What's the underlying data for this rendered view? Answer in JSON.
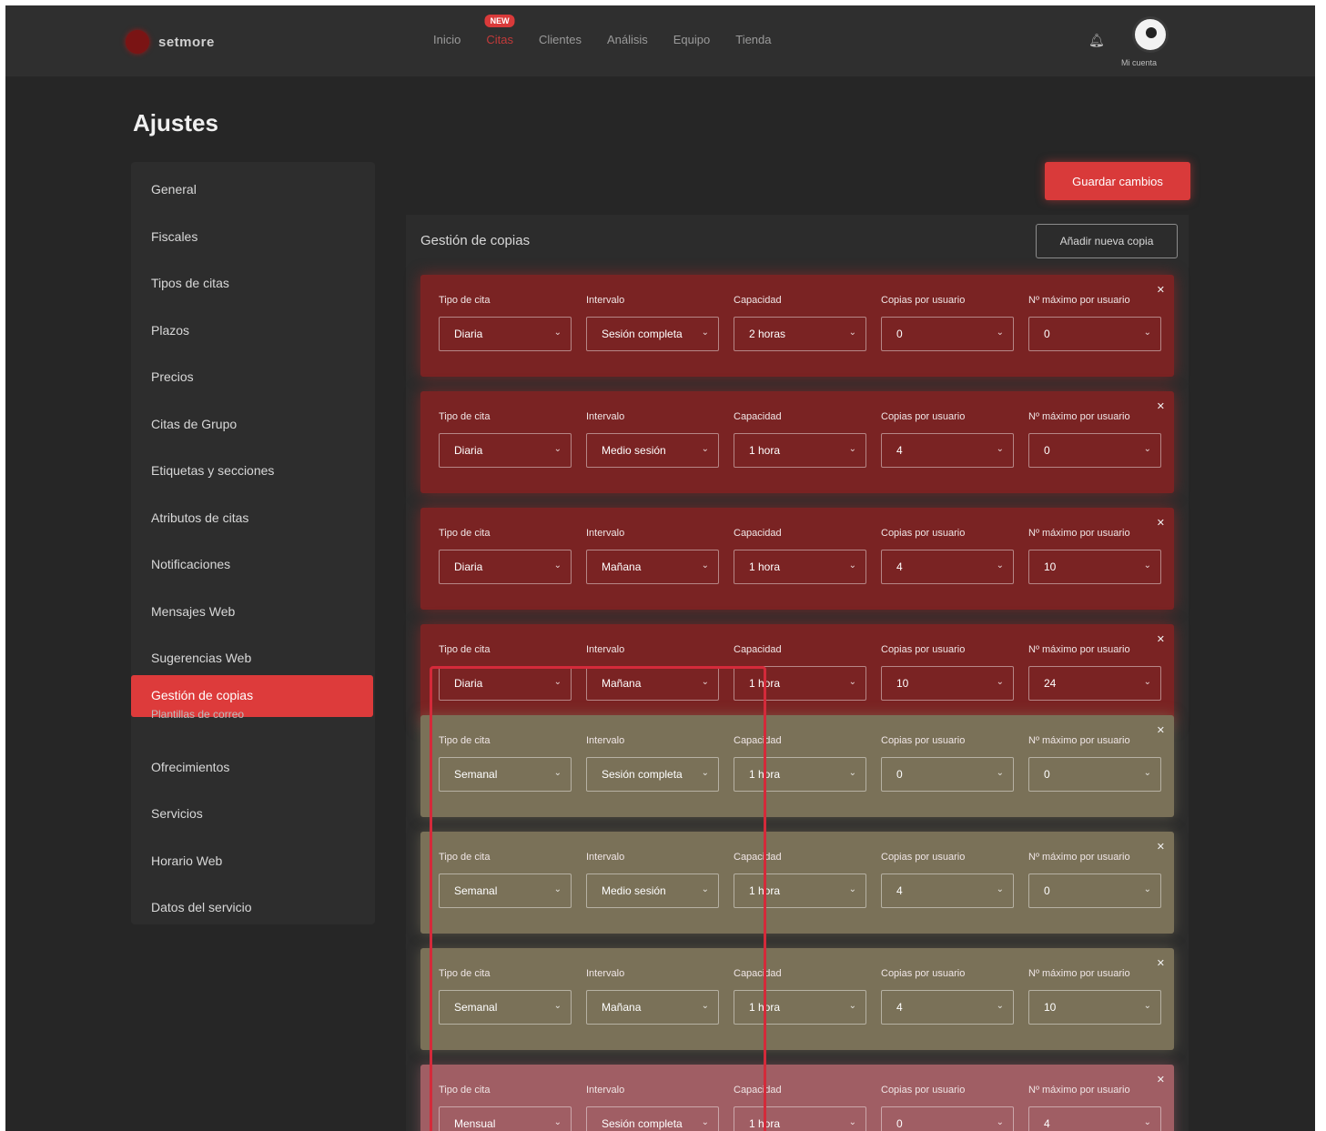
{
  "page": {
    "title": "Ajustes"
  },
  "header": {
    "logo_text": "setmore",
    "nav": [
      {
        "label": "Inicio"
      },
      {
        "label": "Citas",
        "badge": "NEW",
        "active": true
      },
      {
        "label": "Clientes"
      },
      {
        "label": "Análisis"
      },
      {
        "label": "Equipo"
      },
      {
        "label": "Tienda"
      }
    ],
    "user_label": "Mi cuenta"
  },
  "sidebar": {
    "items": [
      {
        "label": "General"
      },
      {
        "label": "Fiscales"
      },
      {
        "label": "Tipos de citas"
      },
      {
        "label": "Plazos"
      },
      {
        "label": "Precios"
      },
      {
        "label": "Citas de Grupo"
      },
      {
        "label": "Etiquetas y secciones"
      },
      {
        "label": "Atributos de citas"
      },
      {
        "label": "Notificaciones"
      },
      {
        "label": "Mensajes Web"
      },
      {
        "label": "Sugerencias Web"
      },
      {
        "label": "Plantillas de correo"
      },
      {
        "label": "Ofrecimientos"
      },
      {
        "label": "Servicios"
      },
      {
        "label": "Horario Web"
      },
      {
        "label": "Datos del servicio"
      }
    ],
    "active_label": "Gestión de copias"
  },
  "toolbar": {
    "save_label": "Guardar cambios"
  },
  "section": {
    "title": "Gestión de copias",
    "add_label": "Añadir nueva copia"
  },
  "field_labels": [
    "Tipo de cita",
    "Intervalo",
    "Capacidad",
    "Copias por usuario",
    "Nº máximo por usuario"
  ],
  "rules": [
    {
      "tipo": "Diaria",
      "intervalo": "Sesión completa",
      "capacidad": "2 horas",
      "copias": "0",
      "maximo": "0",
      "tone": "red"
    },
    {
      "tipo": "Diaria",
      "intervalo": "Medio sesión",
      "capacidad": "1 hora",
      "copias": "4",
      "maximo": "0",
      "tone": "red"
    },
    {
      "tipo": "Diaria",
      "intervalo": "Mañana",
      "capacidad": "1 hora",
      "copias": "4",
      "maximo": "10",
      "tone": "red"
    },
    {
      "tipo": "Diaria",
      "intervalo": "Mañana",
      "capacidad": "1 hora",
      "copias": "10",
      "maximo": "24",
      "tone": "red"
    },
    {
      "tipo": "Semanal",
      "intervalo": "Sesión completa",
      "capacidad": "1 hora",
      "copias": "0",
      "maximo": "0",
      "tone": "olive"
    },
    {
      "tipo": "Semanal",
      "intervalo": "Medio sesión",
      "capacidad": "1 hora",
      "copias": "4",
      "maximo": "0",
      "tone": "olive"
    },
    {
      "tipo": "Semanal",
      "intervalo": "Mañana",
      "capacidad": "1 hora",
      "copias": "4",
      "maximo": "10",
      "tone": "olive"
    },
    {
      "tipo": "Mensual",
      "intervalo": "Sesión completa",
      "capacidad": "1 hora",
      "copias": "0",
      "maximo": "4",
      "tone": "pink"
    }
  ],
  "colors": {
    "accent": "#dd3b3b",
    "card_red": "#7a2323",
    "card_olive": "#7a7158",
    "card_pink": "#a05e64",
    "highlight": "#d42a3a"
  }
}
